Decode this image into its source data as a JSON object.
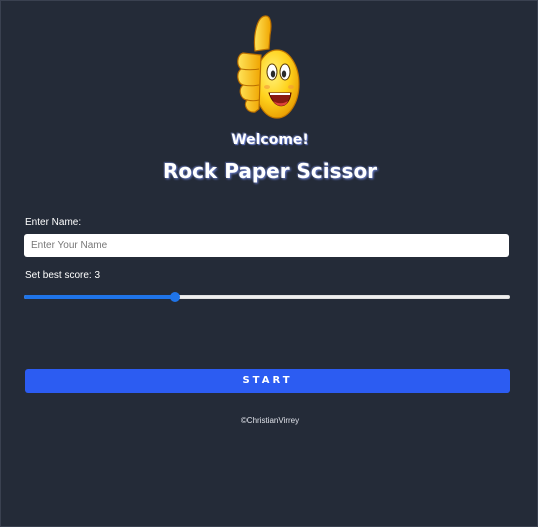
{
  "header": {
    "welcome": "Welcome!",
    "title": "Rock Paper Scissor",
    "emoji": "thumbs-up-smiley-icon"
  },
  "form": {
    "name_label": "Enter Name:",
    "name_placeholder": "Enter Your Name",
    "name_value": "",
    "score_label_prefix": "Set best score: ",
    "score_value": "3",
    "slider_fraction": 0.31
  },
  "actions": {
    "start_label": "START"
  },
  "footer": {
    "credit": "©ChristianVirrey"
  },
  "colors": {
    "background": "#242b38",
    "accent": "#2c5cf2",
    "slider": "#1f74e8"
  }
}
